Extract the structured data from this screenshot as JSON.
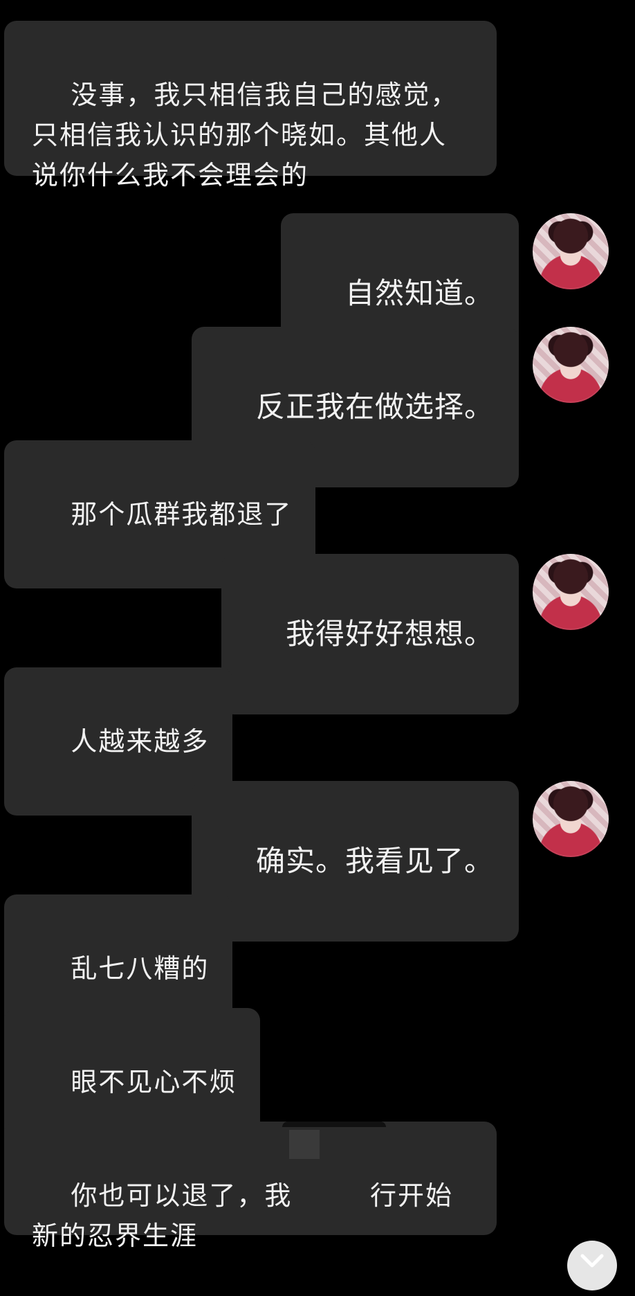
{
  "messages": [
    {
      "side": "left",
      "text": "没事，我只相信我自己的感觉，只相信我认识的那个晓如。其他人说你什么我不会理会的"
    },
    {
      "side": "right",
      "text": "自然知道。"
    },
    {
      "side": "right",
      "text": "反正我在做选择。"
    },
    {
      "side": "left",
      "text": "那个瓜群我都退了"
    },
    {
      "side": "right",
      "text": "我得好好想想。"
    },
    {
      "side": "left",
      "text": "人越来越多"
    },
    {
      "side": "right",
      "text": "确实。我看见了。"
    },
    {
      "side": "left",
      "text": "乱七八糟的"
    },
    {
      "side": "left",
      "text": "眼不见心不烦"
    },
    {
      "side": "left",
      "text": "你也可以退了，我        行开始新的忍界生涯"
    }
  ],
  "avatar": {
    "icon": "user-avatar-icon"
  },
  "scroll_button": {
    "icon": "chevron-down-icon"
  },
  "colors": {
    "background": "#000000",
    "bubble": "#2a2a2a",
    "text": "#f2f2f2"
  }
}
